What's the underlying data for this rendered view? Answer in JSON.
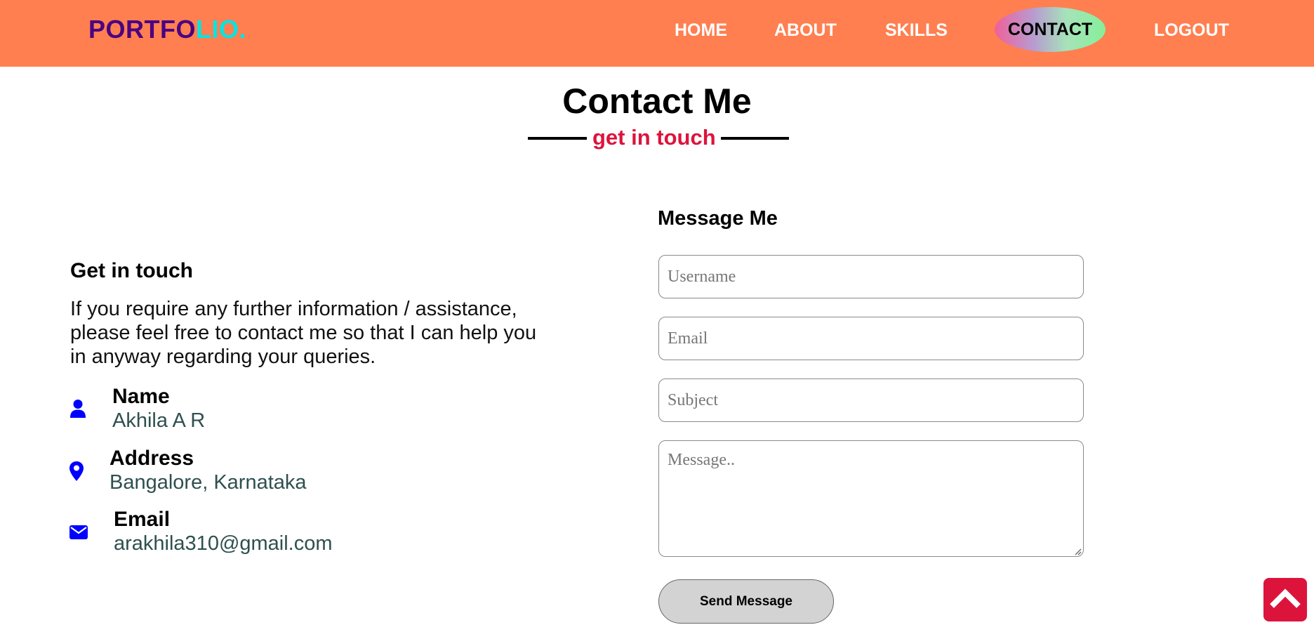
{
  "header": {
    "logo_part1": "PORTFO",
    "logo_part2": "LIO.",
    "nav": {
      "home": "HOME",
      "about": "ABOUT",
      "skills": "SKILLS",
      "contact": "CONTACT",
      "logout": "LOGOUT"
    }
  },
  "section": {
    "title": "Contact Me",
    "subtitle": "get in touch"
  },
  "contact_info": {
    "heading": "Get in touch",
    "description": "If you require any further information / assistance, please feel free to contact me so that I can help you in anyway regarding your queries.",
    "items": [
      {
        "icon": "user-icon",
        "label": "Name",
        "value": "Akhila A R"
      },
      {
        "icon": "map-marker-icon",
        "label": "Address",
        "value": "Bangalore, Karnataka"
      },
      {
        "icon": "envelope-icon",
        "label": "Email",
        "value": "arakhila310@gmail.com"
      }
    ]
  },
  "form": {
    "heading": "Message Me",
    "username_placeholder": "Username",
    "email_placeholder": "Email",
    "subject_placeholder": "Subject",
    "message_placeholder": "Message..",
    "send_label": "Send Message"
  },
  "colors": {
    "navbar": "#ff7f50",
    "logo_primary": "#4b0082",
    "logo_accent": "#00e5e5",
    "subtitle": "#dc143c",
    "icons": "#0000ff",
    "back_to_top": "#dc143c"
  }
}
